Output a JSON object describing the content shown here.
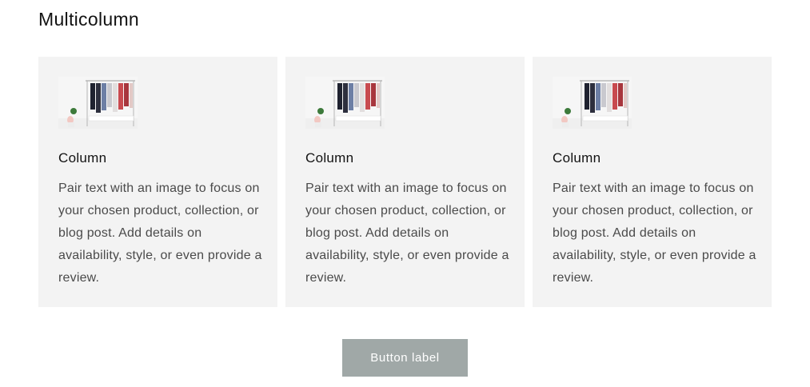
{
  "section": {
    "title": "Multicolumn"
  },
  "columns": [
    {
      "image": "clothing-rack-image",
      "heading": "Column",
      "text": "Pair text with an image to focus on your chosen product, collection, or blog post. Add details on availability, style, or even provide a review."
    },
    {
      "image": "clothing-rack-image",
      "heading": "Column",
      "text": "Pair text with an image to focus on your chosen product, collection, or blog post. Add details on availability, style, or even provide a review."
    },
    {
      "image": "clothing-rack-image",
      "heading": "Column",
      "text": "Pair text with an image to focus on your chosen product, collection, or blog post. Add details on availability, style, or even provide a review."
    }
  ],
  "button": {
    "label": "Button label"
  },
  "colors": {
    "card_background": "#f3f3f3",
    "button_background": "#a0a8a7",
    "button_text": "#ffffff",
    "heading_text": "#121212",
    "body_text": "#4a4a4a"
  }
}
